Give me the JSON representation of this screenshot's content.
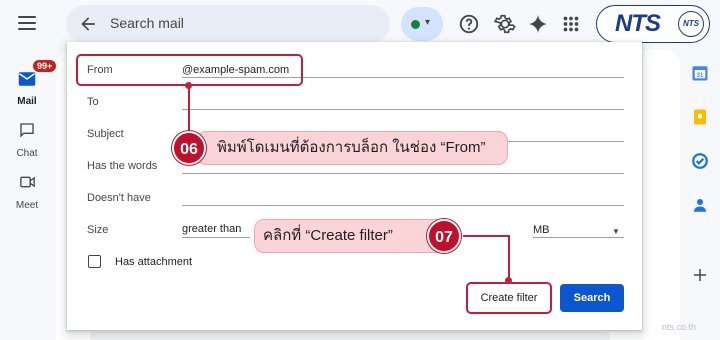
{
  "search": {
    "placeholder": "Search mail"
  },
  "brand": {
    "logo_text": "NTS",
    "badge_text": "NTS"
  },
  "rail": {
    "mail_label": "Mail",
    "mail_badge": "99+",
    "chat_label": "Chat",
    "meet_label": "Meet"
  },
  "filter": {
    "from_label": "From",
    "from_value": "@example-spam.com",
    "to_label": "To",
    "subject_label": "Subject",
    "has_words_label": "Has the words",
    "doesnt_have_label": "Doesn't have",
    "size_label": "Size",
    "size_operator": "greater than",
    "size_unit": "MB",
    "has_attachment_label": "Has attachment",
    "create_filter_label": "Create filter",
    "search_label": "Search"
  },
  "callouts": {
    "step6_number": "06",
    "step6_text": "พิมพ์โดเมนที่ต้องการบล็อก ในช่อง “From”",
    "step7_number": "07",
    "step7_text": "คลิกที่ “Create filter”"
  },
  "watermark": "nts.co.th",
  "colors": {
    "accent_red": "#c0102c",
    "callout_bg": "#fbd4d8",
    "search_button": "#0b57d0",
    "brand_blue": "#1a3c8f",
    "status_green": "#188038"
  },
  "icons": {
    "menu": "hamburger-icon",
    "back": "arrow-back-icon",
    "help": "help-icon",
    "settings": "gear-icon",
    "gemini": "sparkle-icon",
    "apps": "apps-grid-icon",
    "mail": "mail-icon",
    "chat": "chat-icon",
    "meet": "video-icon",
    "calendar": "calendar-icon",
    "keep": "keep-icon",
    "tasks": "tasks-icon",
    "contacts": "contacts-icon",
    "add": "plus-icon"
  }
}
